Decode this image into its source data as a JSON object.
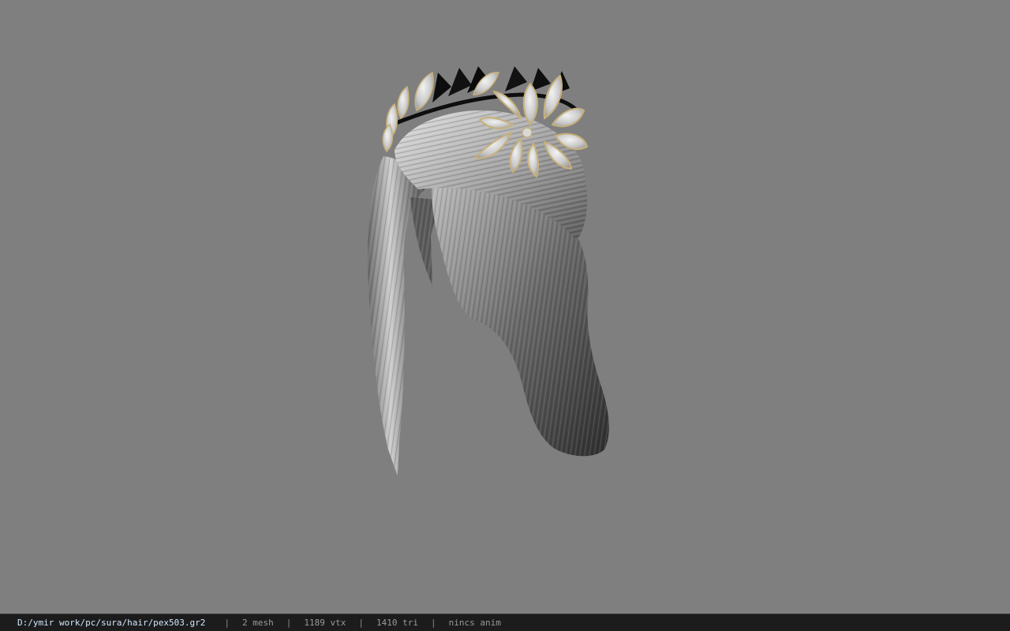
{
  "status": {
    "file_path": "D:/ymir work/pc/sura/hair/pex503.gr2",
    "separator": "|",
    "mesh": "2 mesh",
    "vertices": "1189 vtx",
    "triangles": "1410 tri",
    "anim": "nincs anim"
  },
  "viewport": {
    "background_color": "#7f7f7f",
    "model": "hair-with-leaf-crown-model"
  },
  "colors": {
    "statusbar_bg": "#1c1c1c",
    "path_text": "#d2e8ff",
    "stat_text": "#9a9a9a",
    "hair_light": "#c8c8c8",
    "hair_dark": "#3a3a3a",
    "leaf_silver": "#d9d9d9",
    "leaf_gold_rim": "#c8b07a",
    "leaf_black": "#111111"
  }
}
